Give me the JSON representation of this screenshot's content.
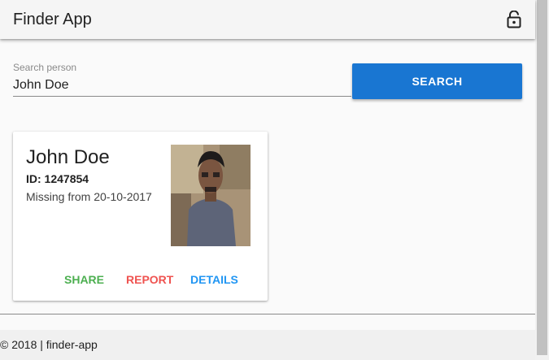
{
  "header": {
    "title": "Finder App",
    "lock_icon": "lock-open-icon"
  },
  "search": {
    "label": "Search person",
    "value": "John Doe",
    "button_label": "SEARCH"
  },
  "card": {
    "name": "John Doe",
    "id": "ID: 1247854",
    "missing": "Missing from 20-10-2017",
    "actions": {
      "share": "SHARE",
      "report": "REPORT",
      "details": "DETAILS"
    }
  },
  "footer": {
    "text": "© 2018 | finder-app"
  },
  "colors": {
    "primary": "#1976d2",
    "share": "#4caf50",
    "report": "#ef5350",
    "details": "#2196f3"
  }
}
